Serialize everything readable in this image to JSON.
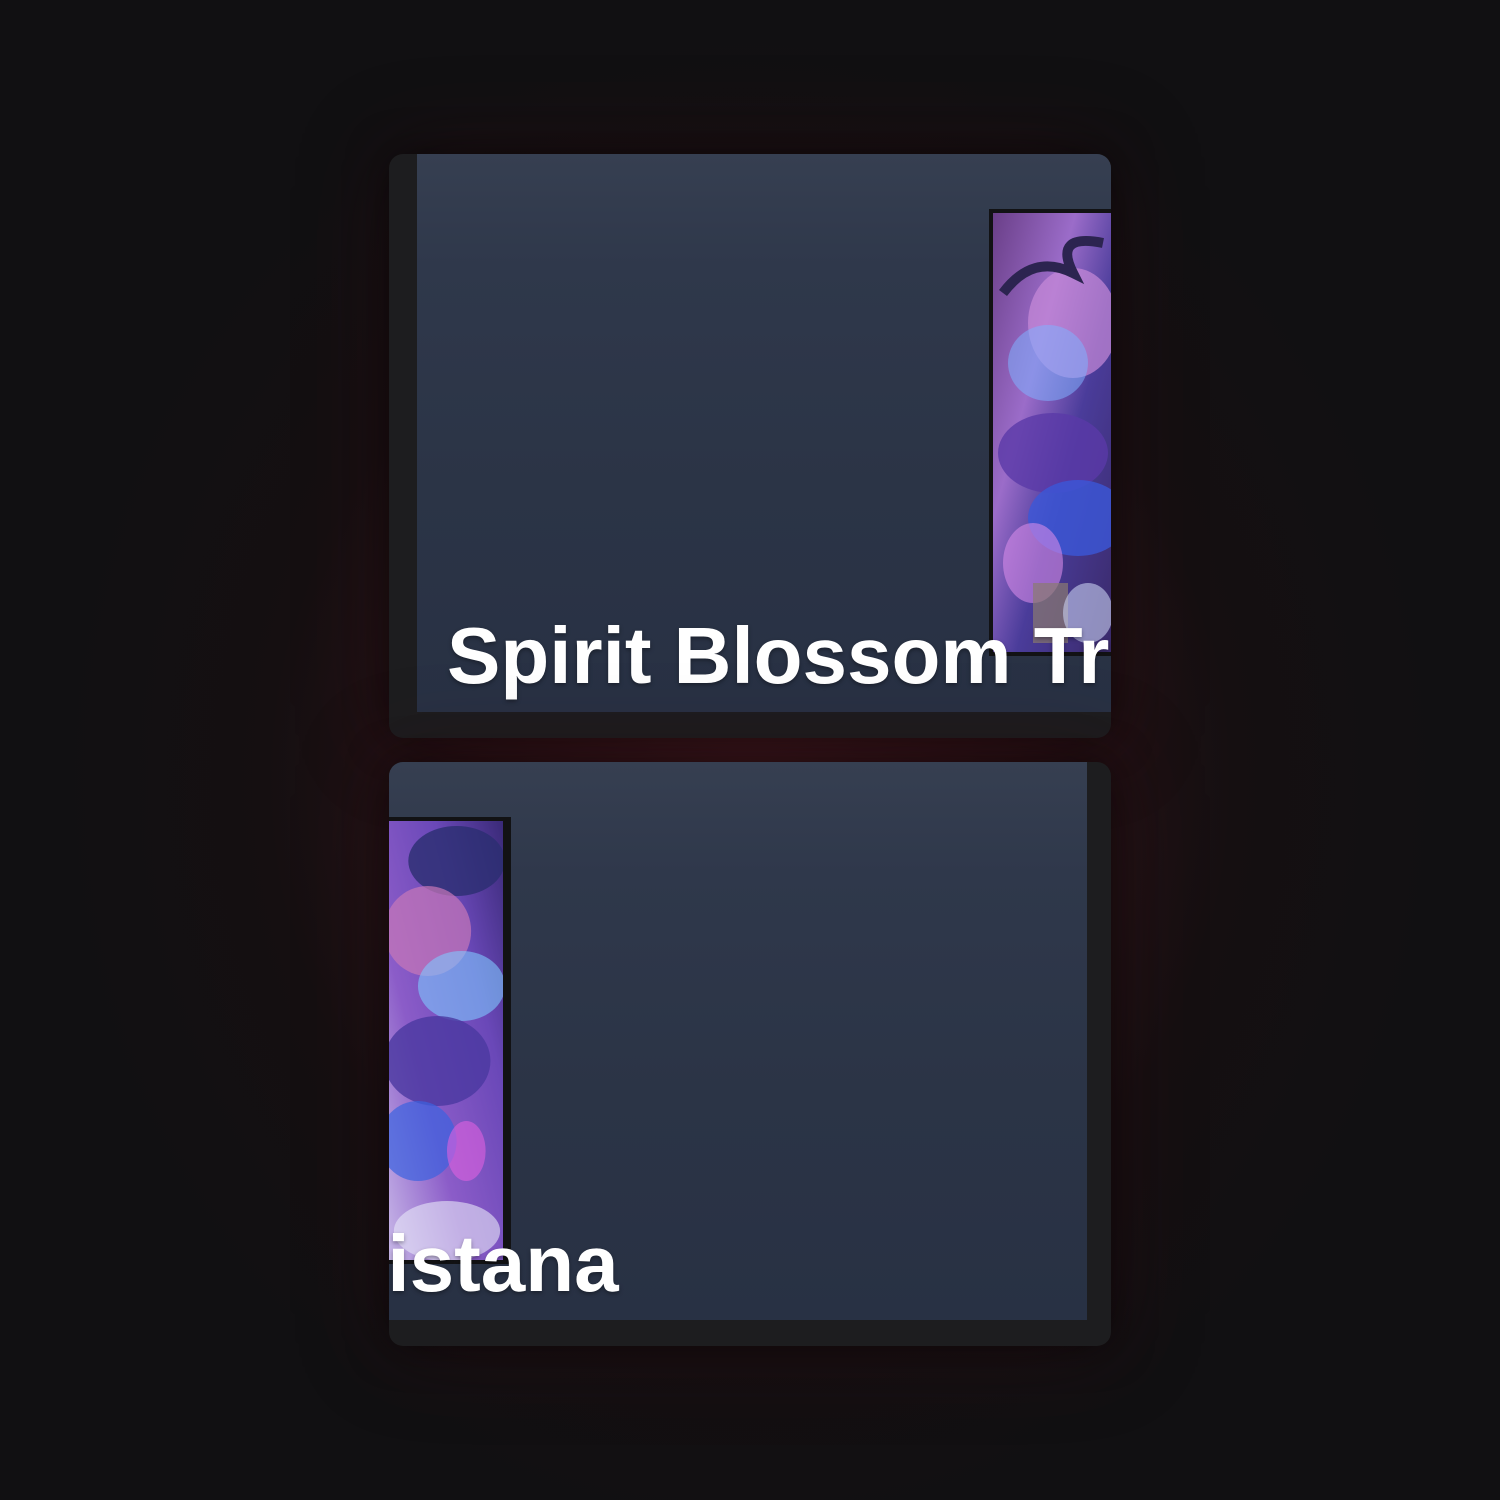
{
  "skin_card": {
    "title": "Spirit Blossom Tristana",
    "accent_color": "#2b3446",
    "art_icon": "champion-splash-art"
  }
}
